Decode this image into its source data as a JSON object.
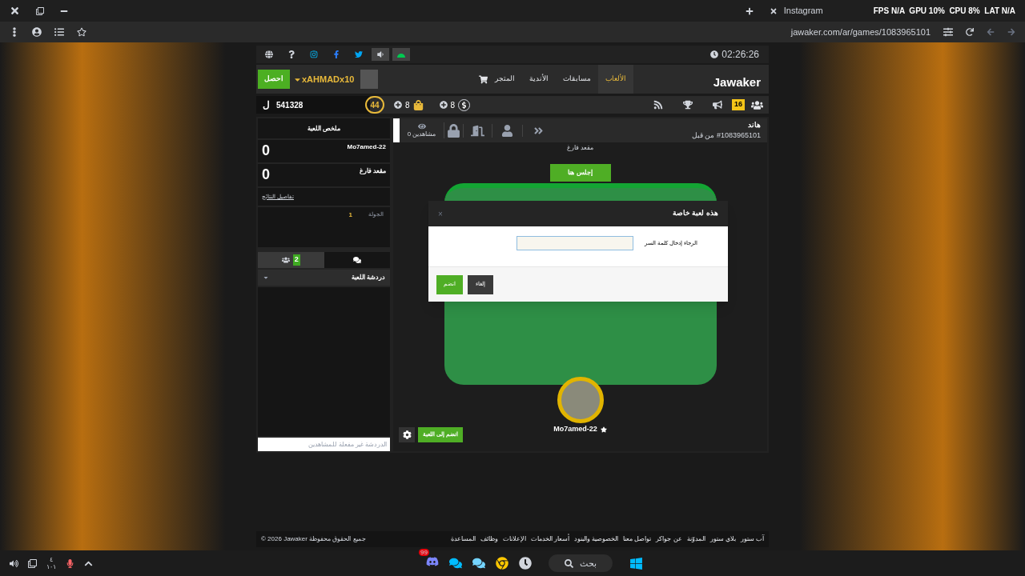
{
  "browser": {
    "tab": "Instagram",
    "url": "jawaker.com/ar/games/1083965101",
    "overlay": "FPS N/A  GPU 10%  CPU 8%  LAT N/A"
  },
  "site_top": {
    "clock": "02:26:26"
  },
  "nav": {
    "logo": "Jawaker",
    "username": "xAHMADx10",
    "get_button": "احصل",
    "items": [
      {
        "label": "الألعاب",
        "selected": true
      },
      {
        "label": "مسابقات",
        "selected": false
      },
      {
        "label": "الأندية",
        "selected": false
      },
      {
        "label": "المتجر",
        "selected": false
      }
    ]
  },
  "stats": {
    "currency": "ل",
    "coins": "541328",
    "level": "44",
    "tokens": "8",
    "gems": "8",
    "friends_online": "16"
  },
  "summary": {
    "title": "ملخص اللعبة",
    "players": [
      {
        "name": "Mo7amed-22",
        "score": "0"
      },
      {
        "name": "مقعد فارغ",
        "score": "0"
      }
    ],
    "details_link": "تفاصيل النتائج",
    "round_label": "الجولة",
    "round": "1"
  },
  "side_tabs": [
    {
      "kind": "players",
      "count": "2",
      "selected": true
    },
    {
      "kind": "chat",
      "selected": false
    }
  ],
  "chat": {
    "title": "دردشة اللعبة",
    "placeholder": "الدردشة غير مفعلة للمشاهدين"
  },
  "game": {
    "name": "هاند",
    "owner": "#1083965101 من قبل",
    "spectators": "0 مشاهدين",
    "seat_label": "مقعد فارغ",
    "sit_button": "إجلس هنا",
    "player": "Mo7amed-22",
    "join_button": "انضم إلى اللعبة"
  },
  "dialog": {
    "title": "هذه لعبة خاصة",
    "close": "×",
    "label": "الرجاء إدخال كلمة السر",
    "confirm": "انضم",
    "cancel": "إلغاء"
  },
  "footer": {
    "links": [
      "آب ستور",
      "بلاي ستور",
      "المدوّنة",
      "عن جواكر",
      "تواصل معنا",
      "الخصوصية والبنود",
      "أسعار الخدمات",
      "الإعلانات",
      "وظائف",
      "المساعدة"
    ],
    "copyright": "© 2026 Jawaker جميع الحقوق محفوظة"
  },
  "taskbar": {
    "search": "بحث",
    "badge": "99",
    "time": "٤",
    "date": "١٠١"
  }
}
